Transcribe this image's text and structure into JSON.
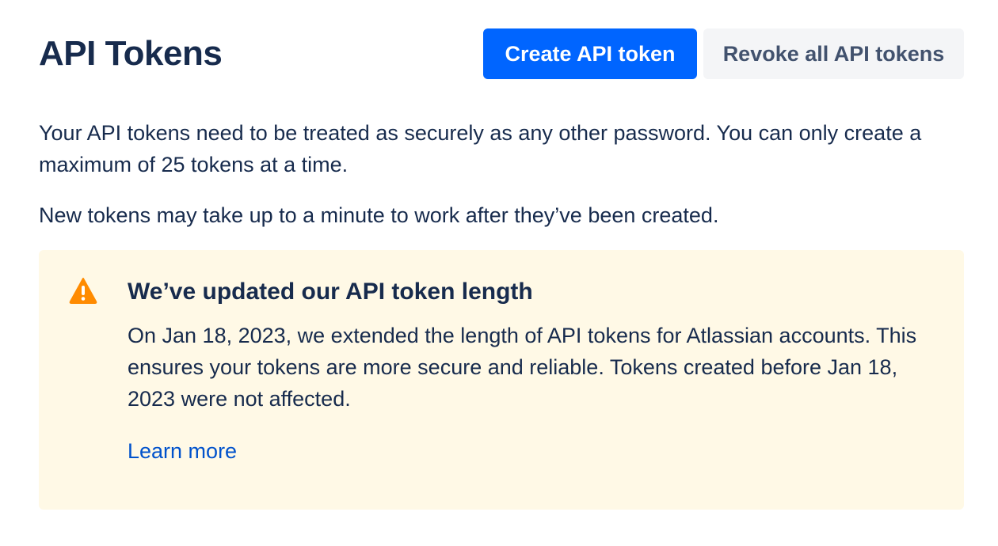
{
  "page": {
    "title": "API Tokens",
    "description_1": "Your API tokens need to be treated as securely as any other password. You can only create a maximum of 25 tokens at a time.",
    "description_2": "New tokens may take up to a minute to work after they’ve been created."
  },
  "actions": {
    "create_label": "Create API token",
    "revoke_label": "Revoke all API tokens"
  },
  "notice": {
    "icon": "warning-icon",
    "title": "We’ve updated our API token length",
    "body": "On Jan 18, 2023, we extended the length of API tokens for Atlassian accounts. This ensures your tokens are more secure and reliable. Tokens created before Jan 18, 2023 were not affected.",
    "link_label": "Learn more"
  },
  "colors": {
    "primary": "#0065FF",
    "text": "#172B4D",
    "notice_bg": "#FFF9E6",
    "warning": "#FF8B00",
    "link": "#0052CC"
  }
}
